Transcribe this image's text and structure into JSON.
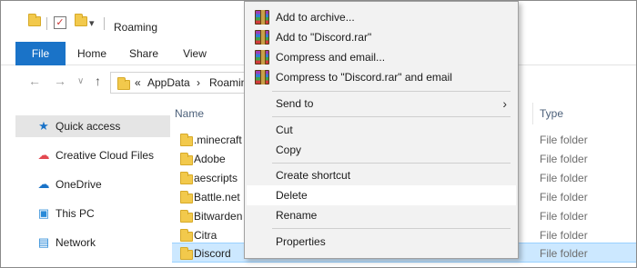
{
  "window": {
    "title": "Roaming",
    "title_menu_glyph": "▾"
  },
  "ribbon": {
    "tabs": [
      "File",
      "Home",
      "Share",
      "View"
    ]
  },
  "address_bar": {
    "overflow": "«",
    "crumbs": [
      "AppData",
      "›",
      "Roamin"
    ]
  },
  "nav_icons": {
    "back": "←",
    "forward": "→",
    "recent": "∨",
    "up": "↑"
  },
  "nav_pane": {
    "items": [
      {
        "label": "Quick access",
        "icon": "star-icon",
        "glyph": "★",
        "color": "#1a73c8"
      },
      {
        "label": "Creative Cloud Files",
        "icon": "creative-cloud-icon",
        "glyph": "☁",
        "color": "#e34850"
      },
      {
        "label": "OneDrive",
        "icon": "cloud-icon",
        "glyph": "☁",
        "color": "#1a73c8"
      },
      {
        "label": "This PC",
        "icon": "computer-icon",
        "glyph": "▣",
        "color": "#2a8ad8"
      },
      {
        "label": "Network",
        "icon": "network-icon",
        "glyph": "▤",
        "color": "#2a8ad8"
      }
    ]
  },
  "file_list": {
    "columns": {
      "name": "Name",
      "type": "Type"
    },
    "rows": [
      {
        "name": ".minecraft",
        "type": "File folder"
      },
      {
        "name": "Adobe",
        "type": "File folder"
      },
      {
        "name": "aescripts",
        "type": "File folder"
      },
      {
        "name": "Battle.net",
        "type": "File folder"
      },
      {
        "name": "Bitwarden",
        "type": "File folder"
      },
      {
        "name": "Citra",
        "type": "File folder"
      },
      {
        "name": "Discord",
        "type": "File folder"
      }
    ]
  },
  "context_menu": {
    "items": [
      {
        "label": "Add to archive...",
        "icon": "winrar-icon"
      },
      {
        "label": "Add to \"Discord.rar\"",
        "icon": "winrar-icon"
      },
      {
        "label": "Compress and email...",
        "icon": "winrar-icon"
      },
      {
        "label": "Compress to \"Discord.rar\" and email",
        "icon": "winrar-icon"
      },
      {
        "label": "Send to",
        "submenu_arrow": "›"
      },
      {
        "label": "Cut"
      },
      {
        "label": "Copy"
      },
      {
        "label": "Create shortcut"
      },
      {
        "label": "Delete"
      },
      {
        "label": "Rename"
      },
      {
        "label": "Properties"
      }
    ]
  },
  "colors": {
    "accent": "#1a73c8",
    "selection": "#cce8ff",
    "menu_bg": "#f2f2f2"
  }
}
